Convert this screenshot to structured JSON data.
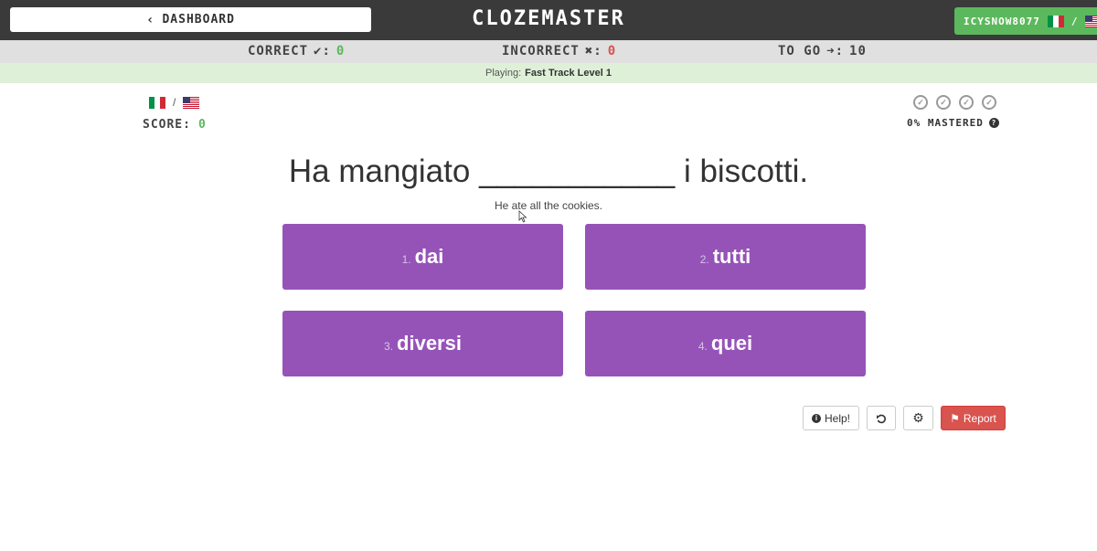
{
  "topbar": {
    "dashboard_label": "DASHBOARD",
    "logo": "CLOZEMASTER",
    "username": "ICYSNOW8077"
  },
  "stats": {
    "correct_label": "CORRECT",
    "correct_value": "0",
    "incorrect_label": "INCORRECT",
    "incorrect_value": "0",
    "togo_label": "TO GO",
    "togo_value": "10"
  },
  "playing": {
    "prefix": "Playing:",
    "level": "Fast Track Level 1"
  },
  "score": {
    "label": "SCORE:",
    "value": "0"
  },
  "mastery": {
    "percent_label": "0% MASTERED"
  },
  "question": {
    "sentence_before": "Ha mangiato",
    "blank": "___________",
    "sentence_after": "i biscotti.",
    "translation": "He ate all the cookies."
  },
  "answers": [
    {
      "index": "1.",
      "word": "dai"
    },
    {
      "index": "2.",
      "word": "tutti"
    },
    {
      "index": "3.",
      "word": "diversi"
    },
    {
      "index": "4.",
      "word": "quei"
    }
  ],
  "buttons": {
    "help": "Help!",
    "report": "Report"
  },
  "colors": {
    "topbar": "#3a3a3a",
    "answer": "#9553b8",
    "correct": "#5cb85c",
    "incorrect": "#d9534f",
    "report": "#d9534f"
  },
  "icons": [
    "chevron-left-icon",
    "check-icon",
    "x-icon",
    "arrow-right-icon",
    "italy-flag-icon",
    "usa-flag-icon",
    "check-circle-icon",
    "question-icon",
    "info-icon",
    "undo-icon",
    "gear-icon",
    "flag-icon"
  ]
}
